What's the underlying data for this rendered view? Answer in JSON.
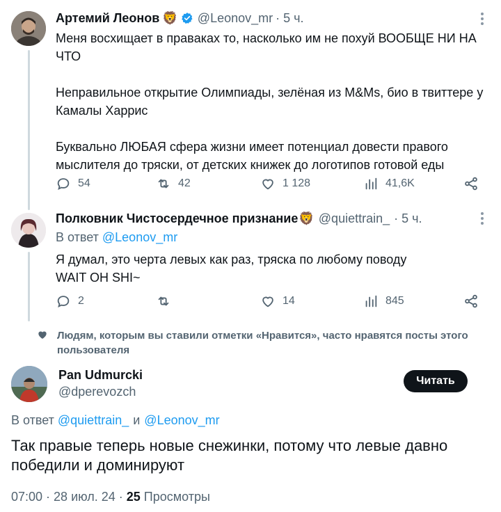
{
  "tweet1": {
    "author_name": "Артемий Леонов",
    "name_emoji": "🦁",
    "handle": "@Leonov_mr",
    "time": "· 5 ч.",
    "paragraphs": [
      "Меня восхищает в правaках то, насколько им не похуй ВООБЩЕ НИ НА ЧТО",
      "Неправильное открытие Олимпиады, зелёная из M&Ms, био в твиттере у Камалы Харрис",
      "Буквально ЛЮБАЯ сфера жизни имеет потенциал довести правого мыслителя до тряски, от детских книжек до логотипов готовой еды"
    ],
    "replies": "54",
    "retweets": "42",
    "likes": "1 128",
    "views": "41,6K"
  },
  "tweet2": {
    "author_name": "Полковник Чистосердечное признание",
    "name_emoji": "🦁",
    "handle": "@quiettrain_",
    "time": "· 5 ч.",
    "reply_prefix": "В ответ",
    "reply_to": "@Leonov_mr",
    "lines": [
      "Я думал, это черта левых как раз, тряска по любому поводу",
      "WAIT OH SHI~"
    ],
    "replies": "2",
    "retweets": "",
    "likes": "14",
    "views": "845"
  },
  "suggestion": {
    "text": "Людям, которым вы ставили отметки «Нравится», часто нравятся посты этого пользователя"
  },
  "main": {
    "author_name": "Pan Udmurcki",
    "handle": "@dperevozch",
    "follow_label": "Читать",
    "reply_prefix": "В ответ",
    "reply_to_1": "@quiettrain_",
    "reply_and": "и",
    "reply_to_2": "@Leonov_mr",
    "text": "Так правые теперь новые снежинки, потому что левые давно победили и доминируют",
    "timestamp": "07:00 · 28 июл. 24 ·",
    "views_count": "25",
    "views_label": "Просмотры"
  },
  "colors": {
    "accent": "#1d9bf0",
    "secondary_text": "#536471",
    "verified": "#1d9bf0"
  }
}
